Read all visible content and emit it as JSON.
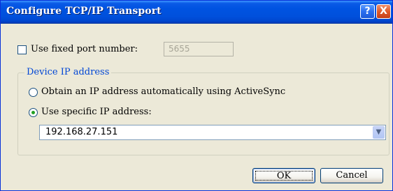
{
  "window": {
    "title": "Configure TCP/IP Transport",
    "help_glyph": "?",
    "close_glyph": "X"
  },
  "port": {
    "checkbox_label": "Use fixed port number:",
    "checked": false,
    "value": "5655",
    "enabled": false
  },
  "device_ip": {
    "group_label": "Device IP address",
    "option_auto_label": "Obtain an IP address automatically using ActiveSync",
    "option_specific_label": "Use specific IP address:",
    "selected_option": "specific",
    "ip_value": "192.168.27.151",
    "dropdown_glyph": "▼"
  },
  "buttons": {
    "ok_label": "OK",
    "cancel_label": "Cancel"
  },
  "colors": {
    "titlebar": "#0054e3",
    "dialog_bg": "#ece9d8",
    "group_label": "#0046d5",
    "radio_selected": "#22a022"
  }
}
